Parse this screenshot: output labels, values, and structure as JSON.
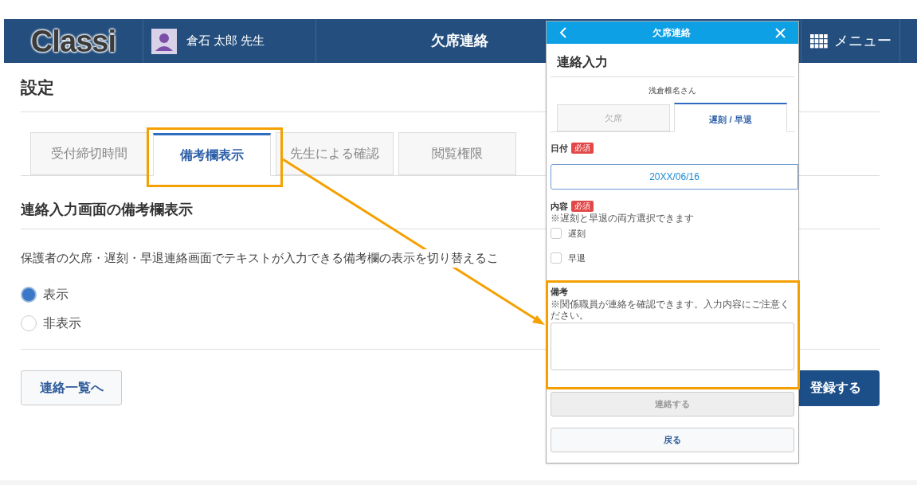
{
  "header": {
    "logo": "Classi",
    "user_name": "倉石 太郎 先生",
    "title": "欠席連絡",
    "menu": "メニュー"
  },
  "page": {
    "heading": "設定",
    "tabs": [
      {
        "label": "受付締切時間",
        "selected": false
      },
      {
        "label": "備考欄表示",
        "selected": true
      },
      {
        "label": "先生による確認",
        "selected": false
      },
      {
        "label": "閲覧権限",
        "selected": false
      }
    ],
    "section_title": "連絡入力画面の備考欄表示",
    "description": "保護者の欠席・遅刻・早退連絡画面でテキストが入力できる備考欄の表示を切り替えるこ",
    "radios": [
      {
        "label": "表示",
        "selected": true
      },
      {
        "label": "非表示",
        "selected": false
      }
    ],
    "back_button": "連絡一覧へ",
    "submit_button": "登録する"
  },
  "popup": {
    "title": "欠席連絡",
    "heading": "連絡入力",
    "student": "浅倉椎名さん",
    "tabs": [
      {
        "label": "欠席",
        "selected": false
      },
      {
        "label": "遅刻 / 早退",
        "selected": true
      }
    ],
    "date_label": "日付",
    "date_badge": "必須",
    "date_value": "20XX/06/16",
    "content_label": "内容",
    "content_badge": "必須",
    "content_note": "※遅刻と早退の両方選択できます",
    "checkboxes": [
      {
        "label": "遅刻",
        "checked": false
      },
      {
        "label": "早退",
        "checked": false
      }
    ],
    "remarks_label": "備考",
    "remarks_note": "※関係職員が連絡を確認できます。入力内容にご注意ください。",
    "submit_button": {
      "label": "連絡する",
      "disabled": true
    },
    "back_button": "戻る"
  }
}
